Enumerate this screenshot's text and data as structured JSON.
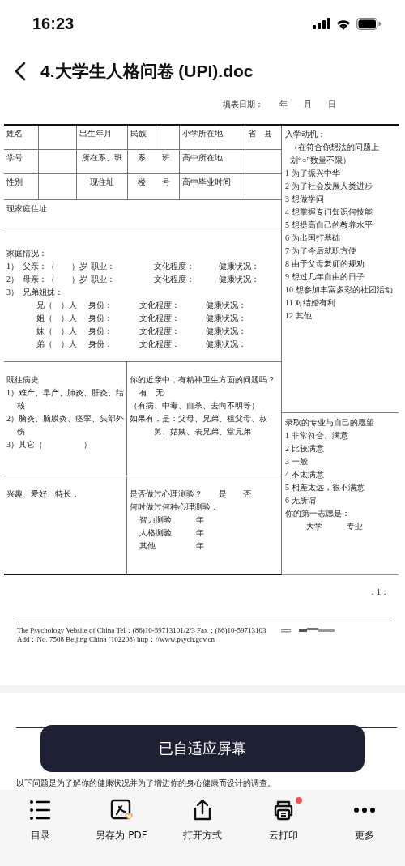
{
  "status_bar": {
    "time": "16:23"
  },
  "header": {
    "title": "4.大学生人格问卷 (UPI).doc"
  },
  "page_1": {
    "fill_date": "填表日期：　　年　　月　　日",
    "top_rows": [
      {
        "cells": [
          "姓名",
          "出生年月",
          "民族",
          "小学所在地",
          "省　县"
        ]
      },
      {
        "cells": [
          "学号",
          "所在系、班",
          "系　　班",
          "高中所在地"
        ]
      },
      {
        "cells": [
          "性别",
          "现住址",
          "楼　　号",
          "高中毕业时间"
        ]
      }
    ],
    "home_address": "现家庭住址",
    "family": {
      "title": "家庭情况：",
      "parents": [
        {
          "num": "1）",
          "who": "父亲：（　　）岁",
          "job": "职业：",
          "edu": "文化程度：",
          "health": "健康状况："
        },
        {
          "num": "2）",
          "who": "母亲：（　　）岁",
          "job": "职业：",
          "edu": "文化程度：",
          "health": "健康状况："
        }
      ],
      "siblings_heading": {
        "num": "3）",
        "text": "兄弟姐妹："
      },
      "siblings": [
        {
          "who": "兄（　）人",
          "role": "身份：",
          "edu": "文化程度：",
          "health": "健康状况："
        },
        {
          "who": "姐（　）人",
          "role": "身份：",
          "edu": "文化程度：",
          "health": "健康状况："
        },
        {
          "who": "妹（　）人",
          "role": "身份：",
          "edu": "文化程度：",
          "health": "健康状况："
        },
        {
          "who": "弟（　）人",
          "role": "身份：",
          "edu": "文化程度：",
          "health": "健康状况："
        }
      ]
    },
    "medical_history": {
      "title": "既往病史",
      "items": [
        "1）难产、早产、肺炎、肝炎、结核",
        "2）脑炎、脑膜炎、痉挛、头部外伤",
        "3）其它（　　　　　）"
      ]
    },
    "relatives": {
      "question": "你的近亲中，有精神卫生方面的问题吗？",
      "answers": "有　无",
      "note": "（有病、中毒、自杀、去向不明等）",
      "if_yes": "如果有，是：父母、兄弟、祖父母、叔舅、姑姨、表兄弟、堂兄弟"
    },
    "hobbies": "兴趣、爱好、特长：",
    "tests": {
      "question": "是否做过心理测验？　　是　　否",
      "when": "何时做过何种心理测验：",
      "items": [
        {
          "name": "智力测验",
          "unit": "年"
        },
        {
          "name": "人格测验",
          "unit": "年"
        },
        {
          "name": "其他",
          "unit": "年"
        }
      ]
    },
    "motives": {
      "title": "入学动机：",
      "note": "（在符合你想法的问题上划“○”数量不限）",
      "options": [
        "1 为了振兴中华",
        "2 为了社会发展人类进步",
        "3 想做学问",
        "4 想掌握专门知识何技能",
        "5 想提高自己的教养水平",
        "6 为出国打基础",
        "7 为了今后就职方便",
        "8 由于父母老师的规劝",
        "9 想过几年自由的日子",
        "10 想参加丰富多彩的社团活动",
        "11 对结婚有利",
        "12 其他"
      ]
    },
    "admission": {
      "title": "录取的专业与自己的愿望",
      "options": [
        "1 非常符合、满意",
        "2 比较满意",
        "3 一般",
        "4 不太满意",
        "5 相差太远，很不满意",
        "6 无所谓"
      ],
      "first_choice": "你的第一志愿是：",
      "university": "大学",
      "major": "专业"
    },
    "page_number": "．1．",
    "footer": [
      "The Psychology  Vebsite of  China  Tel：(86)10-59713101/2/3   Fax：(86)10-59713103",
      "Add：No. 7508 Beijing China (102208)   http：//www.psych.gov.cn"
    ]
  },
  "page_2": {
    "intro": "以下问题是为了解你的健康状况并为了增进你的身心健康而设计的调查。"
  },
  "toast": "已自适应屏幕",
  "toolbar": [
    {
      "kind": "list",
      "label": "目录",
      "badge": false
    },
    {
      "kind": "pdf",
      "label": "另存为 PDF",
      "badge": false
    },
    {
      "kind": "share",
      "label": "打开方式",
      "badge": false
    },
    {
      "kind": "print",
      "label": "云打印",
      "badge": true
    },
    {
      "kind": "more",
      "label": "更多",
      "badge": false
    }
  ]
}
